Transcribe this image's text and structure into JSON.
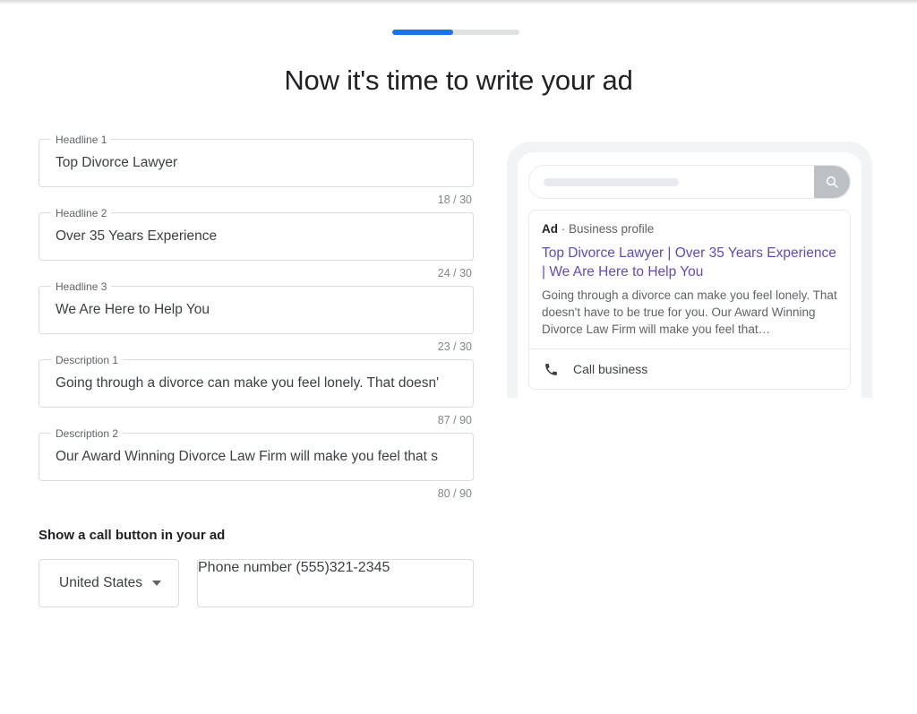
{
  "progress": {
    "percent": 48
  },
  "header": {
    "title": "Now it's time to write your ad"
  },
  "form": {
    "fields": [
      {
        "label": "Headline 1",
        "value": "Top Divorce Lawyer",
        "counter": "18 / 30"
      },
      {
        "label": "Headline 2",
        "value": "Over 35 Years Experience",
        "counter": "24 / 30"
      },
      {
        "label": "Headline 3",
        "value": "We Are Here to Help You",
        "counter": "23 / 30"
      },
      {
        "label": "Description 1",
        "value": "Going through a divorce can make you feel lonely. That doesn'",
        "counter": "87 / 90"
      },
      {
        "label": "Description 2",
        "value": "Our Award Winning Divorce Law Firm will make you feel that s",
        "counter": "80 / 90"
      }
    ],
    "call_section": {
      "heading": "Show a call button in your ad",
      "country_value": "United States",
      "phone_label": "Phone number",
      "phone_value": "(555)321-2345"
    }
  },
  "preview": {
    "ad_label_bold": "Ad",
    "ad_label_rest": " · Business profile",
    "headline": "Top Divorce Lawyer | Over 35 Years Experience | We Are Here to Help You",
    "description": "Going through a divorce can make you feel lonely. That doesn't have to be true for you. Our Award Winning Divorce Law Firm will make you feel that…",
    "action_label": "Call business"
  },
  "colors": {
    "accent": "#1a73e8",
    "link": "#5f4bbd",
    "border": "#dadce0",
    "frame": "#f1f3f4",
    "search_button": "#bdc1c6"
  }
}
